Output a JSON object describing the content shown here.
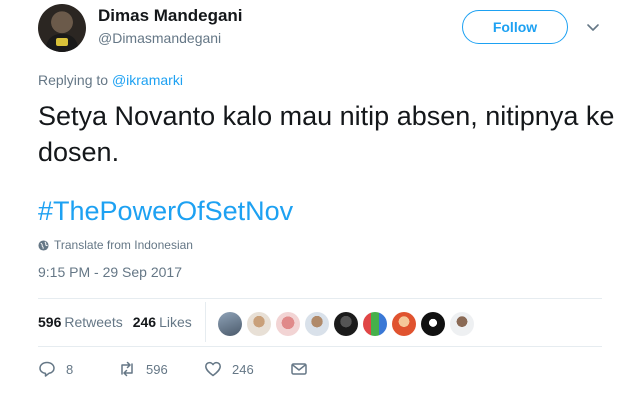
{
  "author": {
    "name": "Dimas Mandegani",
    "handle": "@Dimasmandegani"
  },
  "follow_label": "Follow",
  "replying": {
    "prefix": "Replying to ",
    "handle": "@ikramarki"
  },
  "tweet": {
    "text": "Setya Novanto kalo mau nitip absen, nitipnya ke dosen.",
    "hashtag": "#ThePowerOfSetNov"
  },
  "translate_label": "Translate from Indonesian",
  "timestamp": "9:15 PM - 29 Sep 2017",
  "stats": {
    "retweets_count": "596",
    "retweets_label": "Retweets",
    "likes_count": "246",
    "likes_label": "Likes"
  },
  "actions": {
    "reply_count": "8",
    "retweet_count": "596",
    "like_count": "246"
  },
  "colors": {
    "accent": "#1da1f2",
    "muted": "#657786",
    "text": "#14171a"
  }
}
